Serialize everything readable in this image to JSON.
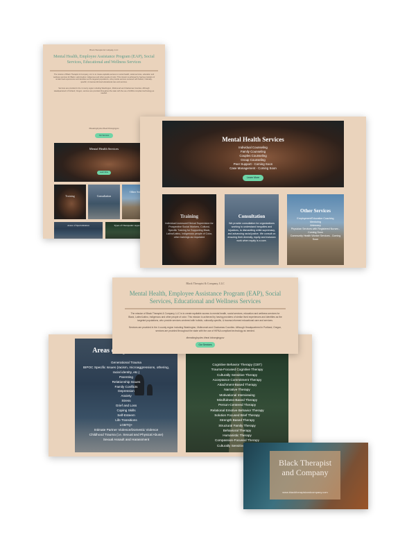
{
  "brand": "Black Therapist & Company, LLC",
  "hero": {
    "title": "Mental Health, Employee Assistance Program (EAP), Social Services, Educational and Wellness Services",
    "intro": "The mission of Black Therapist & Company, LLC is to create equitable access to mental health, social services, education and wellness services for Black, Latinx/Latino, Indigenous and other people of color. This mission is achieved by having providers of similar lived experiences and identities as the targeted populations, who provide services centered with holistic, culturally-specific, & trauma-informed educational care and services.",
    "detail": "Services are provided in the 4 county region including Washington, Multnomah and Clackamas Counties. Although Headquartered in Portland, Oregon, services are provided throughout the state with the use of HIPAA compliant technology as needed.",
    "tagline": "#breakinglcycles #heal #changingpov",
    "button": "Our Services"
  },
  "mental_health": {
    "title": "Mental Health Services",
    "items": [
      "Individual Counseling",
      "Family Counseling",
      "Couples Counseling",
      "Group Counseling",
      "Peer Support - Coming Soon",
      "Case Management - Coming Soon"
    ],
    "button": "Learn More"
  },
  "training": {
    "title": "Training",
    "text": "Individual Licensure/Clinical Supervision for Prospective Social Workers, Cultural-Specific Training for Supporting Black, Latinx/Latino, Indigenous people of Color, other trainings as requested"
  },
  "consultation": {
    "title": "Consultation",
    "text": "We provide consultation for organizations working to understand inequities and injustices, to dismantling white supremacy, and advancing racial justice. We consult on ensuring their diversity, equity and inclusion work when equity is a core."
  },
  "other_services": {
    "title": "Other Services",
    "items": [
      "Employment/Education Coaching",
      "Mentoring",
      "Advocacy",
      "Physician Services with Registered Nurses - Coming Soon",
      "Community Health Worker Services - Coming Soon"
    ]
  },
  "specialization": {
    "title": "Areas of Specialization",
    "items": [
      "Generational Trauma",
      "BIPOC Specific Issues (racism, microaggressions, othering, racial identity, etc.)",
      "Parenting",
      "Relationship Issues",
      "Family Conflicts",
      "Depression",
      "Anxiety",
      "Stress",
      "Grief and Loss",
      "Coping Skills",
      "Self-Esteem",
      "Life Transitions",
      "LGBTQ+",
      "Intimate Partner Violence/Domestic Violence",
      "Childhood Trauma (i.e. Sexual and Physical Abuse)",
      "Sexual Assault and Harassment"
    ]
  },
  "therapeutic": {
    "title": "Types of Therapeutic Approaches",
    "items": [
      "Cognitive Behavior Therapy (CBT)",
      "Trauma-Focused Cognitive Therapy",
      "Culturally Sensitive Therapy",
      "Acceptance Commitment Therapy",
      "Attachment-Based Therapy",
      "Narrative Therapy",
      "Motivational Interviewing",
      "Mindfulness-Based Therapy",
      "Person-Centered Therapy",
      "Relational Emotive Behavior Therapy",
      "Solution Focused Brief Therapy",
      "Strength Based Therapy",
      "Structural Family Therapy",
      "Behavioral Therapy",
      "Humanistic Therapy",
      "Compassion-Focused Therapy",
      "Culturally Sensitive Therapy"
    ]
  },
  "biz_card": {
    "name_line1": "Black Therapist",
    "name_line2": "and Company",
    "url": "www.blacktherapistandcompany.com"
  },
  "colors": {
    "background": "#ead3bc",
    "heading_teal": "#5c9c8a",
    "button_green": "#6fd4a6"
  }
}
